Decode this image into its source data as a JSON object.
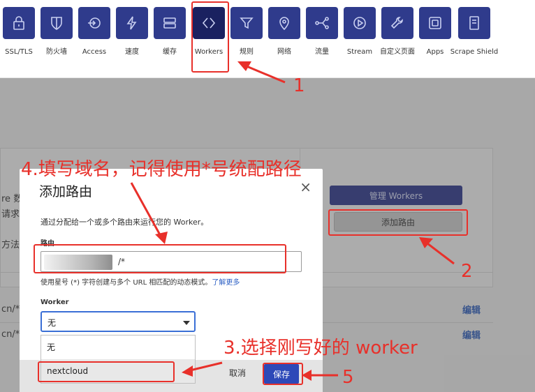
{
  "nav": {
    "items": [
      {
        "label": "SSL/TLS",
        "icon": "lock-icon"
      },
      {
        "label": "防火墙",
        "icon": "shield-icon"
      },
      {
        "label": "Access",
        "icon": "access-icon"
      },
      {
        "label": "速度",
        "icon": "lightning-icon"
      },
      {
        "label": "缓存",
        "icon": "server-icon"
      },
      {
        "label": "Workers",
        "icon": "code-brackets-icon"
      },
      {
        "label": "规则",
        "icon": "filter-icon"
      },
      {
        "label": "网络",
        "icon": "location-pin-icon"
      },
      {
        "label": "流量",
        "icon": "network-icon"
      },
      {
        "label": "Stream",
        "icon": "play-icon"
      },
      {
        "label": "自定义页面",
        "icon": "wrench-icon"
      },
      {
        "label": "Apps",
        "icon": "square-icon"
      },
      {
        "label": "Scrape Shield",
        "icon": "document-icon"
      }
    ]
  },
  "background": {
    "manage_workers": "管理 Workers",
    "add_route": "添加路由",
    "partial_1": "re 数",
    "partial_2": "请求",
    "partial_3": "方法",
    "row1_prefix": "cn/*",
    "row2_prefix": "cn/*",
    "edit": "编辑"
  },
  "modal": {
    "title": "添加路由",
    "close": "×",
    "description": "通过分配给一个或多个路由来运行您的 Worker。",
    "route_label": "路由",
    "route_suffix": "/*",
    "hint": "使用星号 (*) 字符创建与多个 URL 相匹配的动态模式。",
    "hint_link": "了解更多",
    "worker_label": "Worker",
    "worker_selected": "无",
    "worker_options": [
      "无",
      "nextcloud"
    ],
    "cancel": "取消",
    "save": "保存"
  },
  "annotations": {
    "step1": "1",
    "step2": "2",
    "step3": "3.选择刚写好的 worker",
    "step4": "4.填写域名，记得使用*号统配路径",
    "step5": "5",
    "color": "#e8302a"
  }
}
